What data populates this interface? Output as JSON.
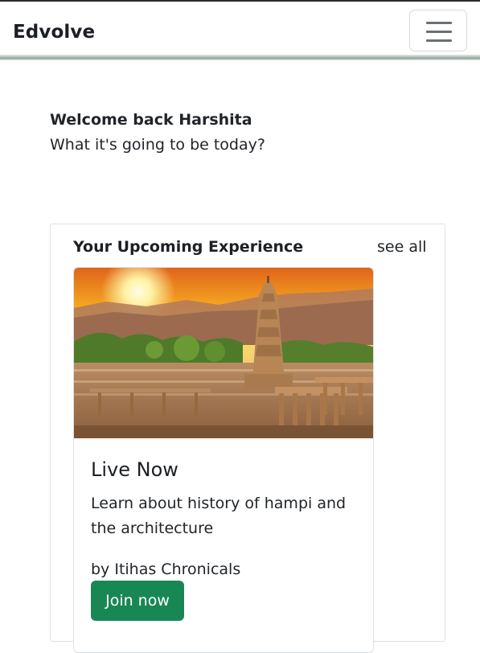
{
  "navbar": {
    "brand": "Edvolve",
    "toggler_icon": "hamburger-menu-icon"
  },
  "welcome": {
    "title": "Welcome back Harshita",
    "subtitle": "What it's going to be today?"
  },
  "upcoming": {
    "section_title": "Your Upcoming Experience",
    "see_all_label": "see all",
    "card": {
      "image_subject": "hampi-temple-sunset-photo",
      "status": "Live Now",
      "description": "Learn about history of hampi and the architecture",
      "author": "by Itihas Chronicals",
      "join_label": "Join now"
    }
  },
  "colors": {
    "primary_button": "#198754",
    "text": "#212529",
    "border": "#dfe1e4"
  }
}
